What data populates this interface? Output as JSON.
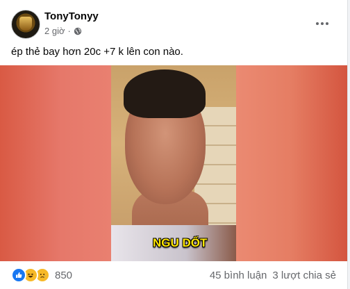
{
  "post": {
    "author": "TonyTonyy",
    "time": "2 giờ",
    "separator": "·",
    "caption": "ép thẻ bay hơn 20c +7 k lên con nào.",
    "video_subtitle": "NGU DỐT"
  },
  "footer": {
    "reaction_count": "850",
    "comments": "45 bình luận",
    "shares": "3 lượt chia sẻ",
    "reaction_icons": [
      "like-icon",
      "haha-icon",
      "sad-icon"
    ]
  },
  "colors": {
    "like": "#1877f2",
    "emoji": "#f7b928",
    "secondary_text": "#65676b",
    "subtitle": "#ffe600"
  }
}
